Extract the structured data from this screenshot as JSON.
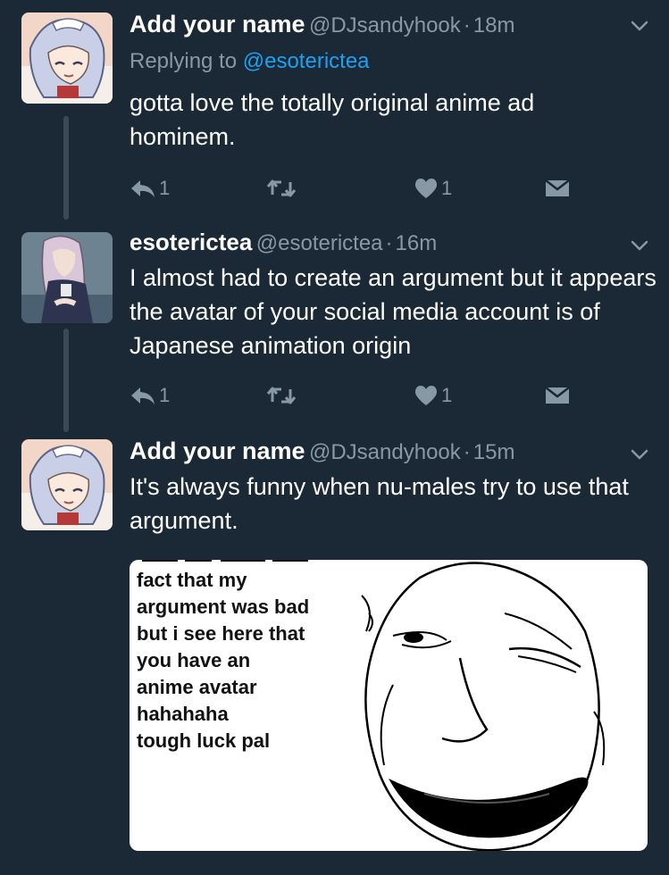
{
  "tweets": [
    {
      "name": "Add your name",
      "handle": "@DJsandyhook",
      "dot": "·",
      "time": "18m",
      "replying_prefix": "Replying to",
      "replying_handle": "@esoterictea",
      "text": "gotta love the totally original anime ad hominem.",
      "reply_count": "1",
      "like_count": "1"
    },
    {
      "name": "esoterictea",
      "handle": "@esoterictea",
      "dot": "·",
      "time": "16m",
      "text": "I almost had to create an argument  but it appears the avatar of your social media account is of Japanese animation origin",
      "reply_count": "1",
      "like_count": "1"
    },
    {
      "name": "Add your name",
      "handle": "@DJsandyhook",
      "dot": "·",
      "time": "15m",
      "text": "It's always funny when nu-males try to use that argument.",
      "meme_text": "fact that my\nargument was bad\nbut i see here that\nyou have an\nanime avatar\nhahahaha\ntough luck pal"
    }
  ],
  "colors": {
    "background": "#1b2836",
    "secondary_text": "#8899a6",
    "link": "#1da1f2",
    "thread_line": "#3b4957"
  },
  "icons": [
    "reply-icon",
    "retweet-icon",
    "like-icon",
    "direct-message-icon",
    "chevron-down-icon"
  ]
}
